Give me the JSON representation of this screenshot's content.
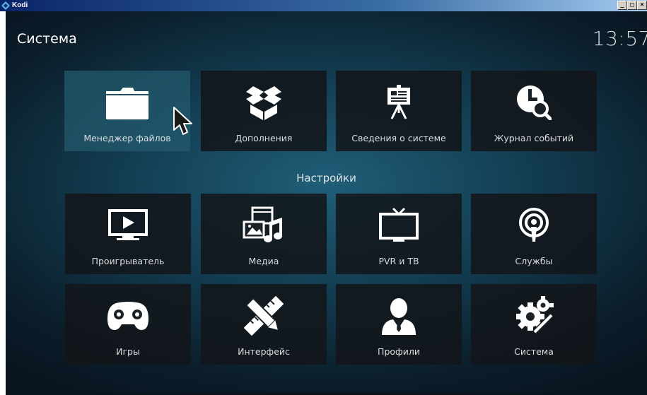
{
  "window": {
    "title": "Kodi",
    "buttons": [
      "_",
      "□",
      "×"
    ]
  },
  "header": {
    "title": "Система",
    "clock": "13:57"
  },
  "top_tiles": [
    {
      "label": "Менеджер файлов",
      "icon": "folder-icon",
      "focused": true
    },
    {
      "label": "Дополнения",
      "icon": "box-icon"
    },
    {
      "label": "Сведения о системе",
      "icon": "presentation-icon"
    },
    {
      "label": "Журнал событий",
      "icon": "clock-search-icon"
    }
  ],
  "settings_heading": "Настройки",
  "settings_tiles": [
    {
      "label": "Проигрыватель",
      "icon": "player-screen-icon"
    },
    {
      "label": "Медиа",
      "icon": "media-icon"
    },
    {
      "label": "PVR и TB",
      "icon": "tv-icon"
    },
    {
      "label": "Службы",
      "icon": "podcast-icon"
    },
    {
      "label": "Игры",
      "icon": "gamepad-icon"
    },
    {
      "label": "Интерфейс",
      "icon": "pencil-ruler-icon"
    },
    {
      "label": "Профили",
      "icon": "user-profile-icon"
    },
    {
      "label": "Система",
      "icon": "gears-icon"
    }
  ],
  "colors": {
    "tile_bg": "#12161a",
    "focused_tile_bg": "#235a6c",
    "background_center": "#1f5e78",
    "text": "#ffffff"
  }
}
